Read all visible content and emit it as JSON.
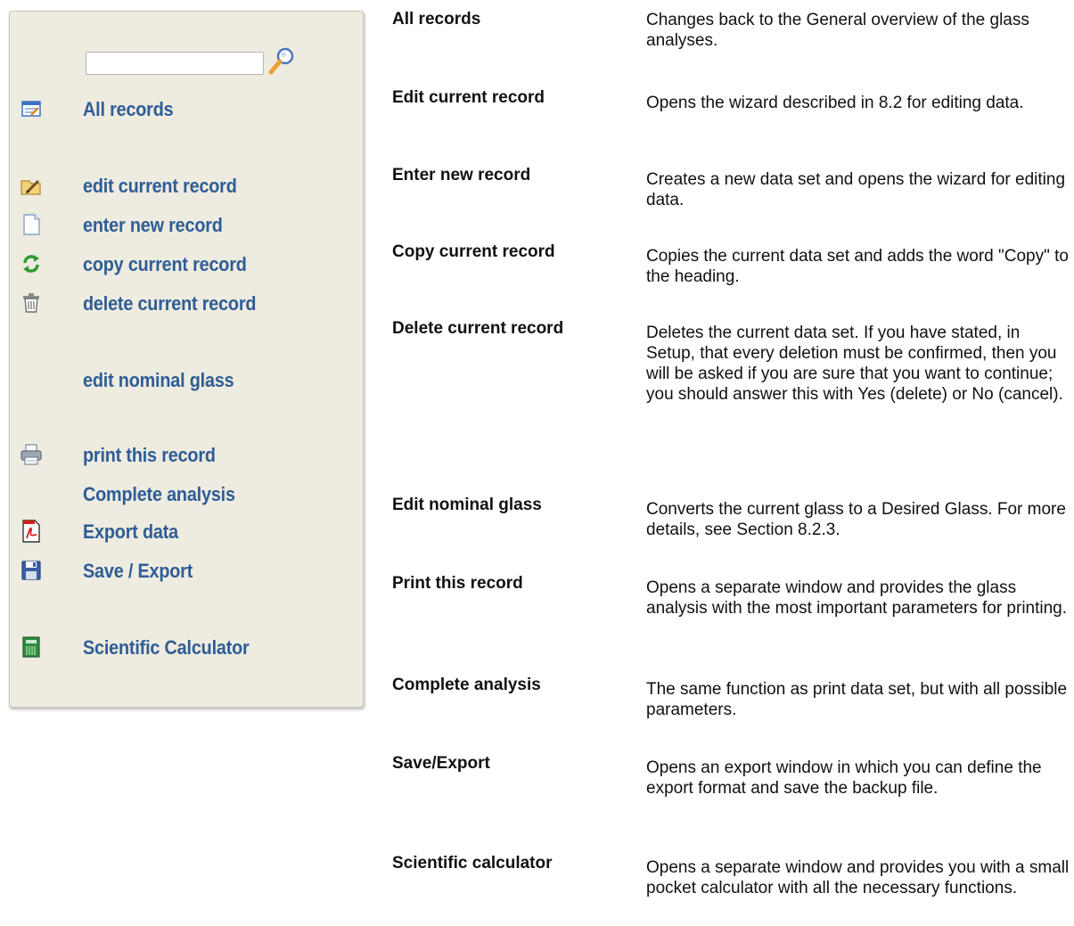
{
  "sidebar": {
    "search": {
      "value": "",
      "placeholder": ""
    },
    "items": [
      {
        "label": "All records",
        "icon": "all-records-icon"
      },
      {
        "label": "edit current record",
        "icon": "edit-icon"
      },
      {
        "label": "enter new record",
        "icon": "new-document-icon"
      },
      {
        "label": "copy current record",
        "icon": "copy-refresh-icon"
      },
      {
        "label": "delete current record",
        "icon": "trash-icon"
      },
      {
        "label": "edit nominal glass",
        "icon": ""
      },
      {
        "label": "print this record",
        "icon": "printer-icon"
      },
      {
        "label": "Complete analysis",
        "icon": ""
      },
      {
        "label": "Export data",
        "icon": "pdf-icon"
      },
      {
        "label": "Save / Export",
        "icon": "floppy-disk-icon"
      },
      {
        "label": "Scientific Calculator",
        "icon": "calculator-icon"
      }
    ],
    "colors": {
      "panel_bg": "#eeebe0",
      "link": "#2e5d96"
    }
  },
  "help": [
    {
      "term": "All records",
      "desc": "Changes back to the General overview of the glass analyses."
    },
    {
      "term": "Edit current record",
      "desc": "Opens the wizard described in 8.2 for editing data."
    },
    {
      "term": "Enter new record",
      "desc": "Creates a new data set and opens the wizard for editing data."
    },
    {
      "term": "Copy current record",
      "desc": "Copies the current data set and adds the word \"Copy\" to the heading."
    },
    {
      "term": "Delete current record",
      "desc": "Deletes the current data set. If you have stated, in Setup, that every deletion must be confirmed, then you will be asked if you are sure that you want to continue; you should answer this with Yes (delete) or No (cancel)."
    },
    {
      "term": "Edit nominal glass",
      "desc": "Converts the current glass to a Desired Glass. For more details, see Section 8.2.3."
    },
    {
      "term": "Print this record",
      "desc": "Opens a separate window and provides the glass analysis with the most important parameters for printing."
    },
    {
      "term": "Complete analysis",
      "desc": "The same function as print data set, but with all possible parameters."
    },
    {
      "term": "Save/Export",
      "desc": "Opens an export window in which you can define the export format and save the backup file."
    },
    {
      "term": "Scientific calculator",
      "desc": "Opens a separate window and provides you with a small pocket calculator with all the necessary functions."
    }
  ]
}
